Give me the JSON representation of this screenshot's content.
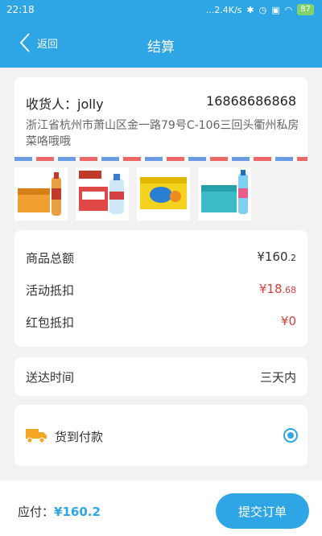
{
  "status_bar": {
    "time": "22:18",
    "network_speed": "...2.4K/s",
    "battery": "87",
    "icons": [
      "bluetooth-icon",
      "alarm-icon",
      "sim-icon",
      "wifi-icon",
      "battery-icon"
    ]
  },
  "nav": {
    "back_label": "返回",
    "title": "结算"
  },
  "address": {
    "receiver": "收货人：jolly",
    "phone": "16868686868",
    "detail": "浙江省杭州市萧山区金一路79号C-106三回头衢州私房菜咯哦哦"
  },
  "goods": [
    {
      "name": "product-tea-box"
    },
    {
      "name": "product-water-box"
    },
    {
      "name": "product-juice-box"
    },
    {
      "name": "product-drink-box"
    }
  ],
  "summary": {
    "total_label": "商品总额",
    "total_value": "¥160",
    "total_decimal": ".2",
    "discount_label": "活动抵扣",
    "discount_value": "¥18",
    "discount_decimal": ".68",
    "redpacket_label": "红包抵扣",
    "redpacket_value": "¥0"
  },
  "delivery": {
    "label": "送达时间",
    "value": "三天内"
  },
  "payment": {
    "label": "货到付款"
  },
  "footer": {
    "payable_label": "应付：",
    "payable_value": "¥160.2",
    "submit_label": "提交订单"
  },
  "colors": {
    "primary": "#2ea6e6",
    "discount_red": "#e23b3b",
    "background": "#f2f2f2"
  }
}
